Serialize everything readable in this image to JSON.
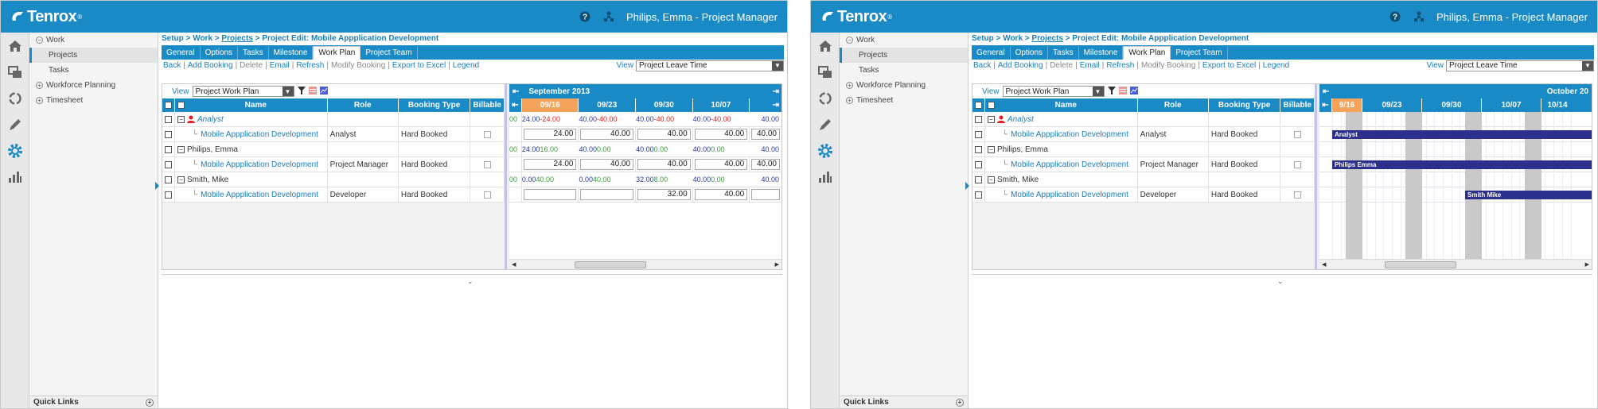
{
  "app": {
    "logo_text": "Tenrox",
    "user_label": "Philips, Emma - Project Manager",
    "brand_color": "#1a8ac7"
  },
  "nav": {
    "items": [
      {
        "label": "Work",
        "toggle": "−"
      },
      {
        "label": "Projects"
      },
      {
        "label": "Tasks"
      },
      {
        "label": "Workforce Planning",
        "toggle": "+"
      },
      {
        "label": "Timesheet",
        "toggle": "+"
      }
    ],
    "quick_links": "Quick Links"
  },
  "breadcrumb": {
    "setup": "Setup",
    "work": "Work",
    "projects": "Projects",
    "current": "Project Edit: Mobile Appplication Development",
    "sep": " > "
  },
  "tabs": [
    "General",
    "Options",
    "Tasks",
    "Milestone",
    "Work Plan",
    "Project Team"
  ],
  "actions": {
    "items": [
      {
        "label": "Back",
        "enabled": true
      },
      {
        "label": "Add Booking",
        "enabled": true
      },
      {
        "label": "Delete",
        "enabled": false
      },
      {
        "label": "Email",
        "enabled": true
      },
      {
        "label": "Refresh",
        "enabled": true
      },
      {
        "label": "Modify Booking",
        "enabled": false
      },
      {
        "label": "Export to Excel",
        "enabled": true
      },
      {
        "label": "Legend",
        "enabled": true
      }
    ],
    "view_label": "View",
    "view_value": "Project Leave Time"
  },
  "grid": {
    "view_label": "View",
    "view_value": "Project Work Plan",
    "columns": {
      "name": "Name",
      "role": "Role",
      "booking_type": "Booking Type",
      "billable": "Billable"
    },
    "rows": [
      {
        "name": "Analyst",
        "role": "",
        "booking_type": "",
        "kind": "role"
      },
      {
        "name": "Mobile Appplication Development",
        "role": "Analyst",
        "booking_type": "Hard Booked",
        "kind": "project"
      },
      {
        "name": "Philips, Emma",
        "role": "",
        "booking_type": "",
        "kind": "person"
      },
      {
        "name": "Mobile Appplication Development",
        "role": "Project Manager",
        "booking_type": "Hard Booked",
        "kind": "project"
      },
      {
        "name": "Smith, Mike",
        "role": "",
        "booking_type": "",
        "kind": "person"
      },
      {
        "name": "Mobile Appplication Development",
        "role": "Developer",
        "booking_type": "Hard Booked",
        "kind": "project"
      }
    ]
  },
  "timeline_numbers": {
    "month": "September 2013",
    "weeks": [
      "09/16",
      "09/23",
      "09/30",
      "10/07"
    ],
    "current_week_index": 0,
    "partial_first": "00",
    "figures": [
      {
        "lead": "00",
        "pairs": [
          [
            "24.00",
            "-24.00"
          ],
          [
            "40.00",
            "-40.00"
          ],
          [
            "40.00",
            "-40.00"
          ],
          [
            "40.00",
            "-40.00"
          ]
        ],
        "tail": "40.00",
        "tones": [
          "blu",
          "neg"
        ]
      },
      {
        "inputs": [
          "24.00",
          "40.00",
          "40.00",
          "40.00"
        ],
        "tail": "40.00"
      },
      {
        "lead": "00",
        "pairs": [
          [
            "24.00",
            "16.00"
          ],
          [
            "40.00",
            "0.00"
          ],
          [
            "40.00",
            "0.00"
          ],
          [
            "40.00",
            "0.00"
          ]
        ],
        "tail": "40.00",
        "tones": [
          "blu",
          "pos"
        ]
      },
      {
        "inputs": [
          "24.00",
          "40.00",
          "40.00",
          "40.00"
        ],
        "tail": "40.00"
      },
      {
        "lead": "00",
        "pairs": [
          [
            "0.00",
            "40.00"
          ],
          [
            "0.00",
            "40.00"
          ],
          [
            "32.00",
            "8.00"
          ],
          [
            "40.00",
            "0.00"
          ]
        ],
        "tail": "40.00",
        "tones": [
          "blu",
          "pos"
        ]
      },
      {
        "inputs": [
          "",
          "",
          "32.00",
          "40.00"
        ],
        "tail": ""
      }
    ]
  },
  "timeline_gantt": {
    "month": "October 20",
    "weeks": [
      "9/16",
      "09/23",
      "09/30",
      "10/07",
      "10/14"
    ],
    "current_week_index": 0,
    "bars": [
      {
        "label": "Analyst",
        "row": 1
      },
      {
        "label": "Philips Emma",
        "row": 3
      },
      {
        "label": "Smith Mike",
        "row": 5
      }
    ]
  }
}
